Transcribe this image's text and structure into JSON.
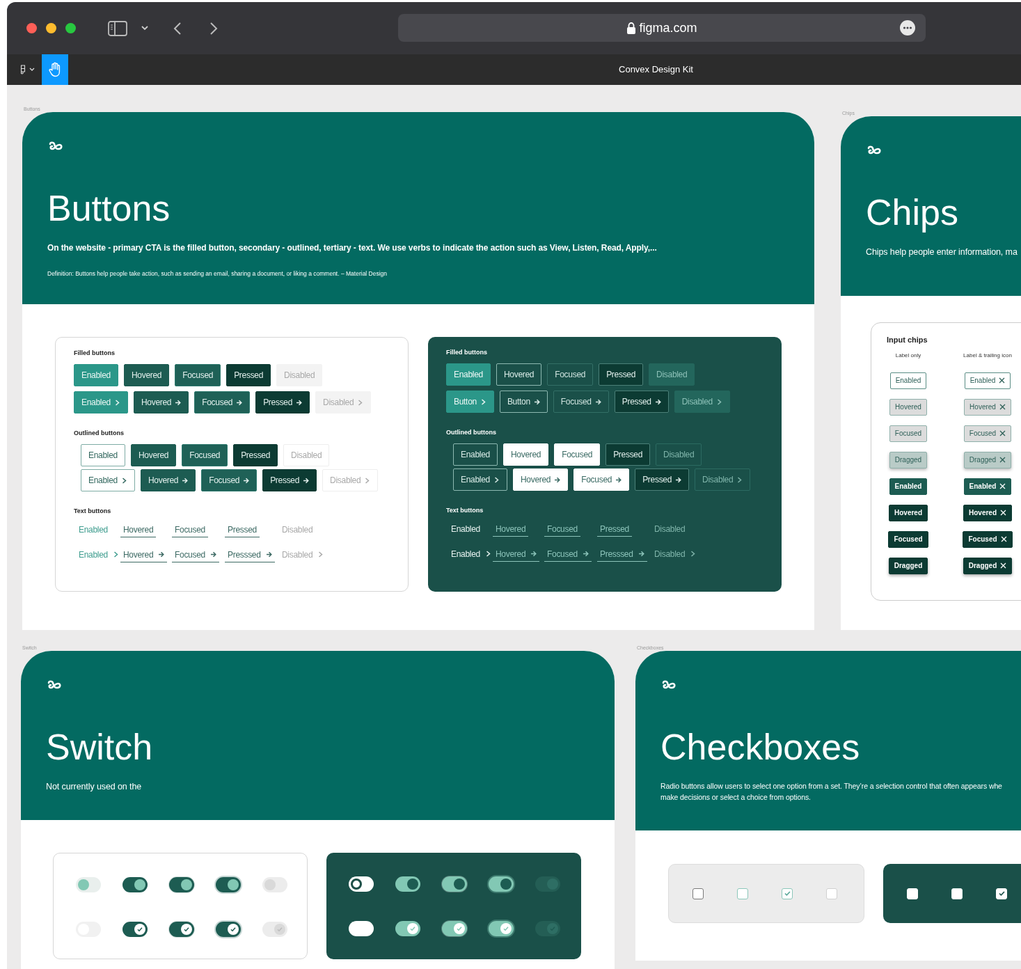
{
  "browser": {
    "url": "figma.com"
  },
  "app_bar": {
    "file_title": "Convex Design Kit",
    "tools": [
      {
        "kind": "main-menu",
        "selected": false
      },
      {
        "kind": "hand",
        "selected": true
      }
    ]
  },
  "frames": [
    {
      "kind": "buttons",
      "label": "Buttons",
      "title": "Buttons",
      "description": "On the website - primary CTA is the filled button, secondary - outlined, tertiary - text. We use verbs to indicate the action such as View, Listen, Read, Apply,...",
      "definition": "Definition: Buttons help people take action, such as sending an email, sharing a document, or liking a comment. – Material Design",
      "panels": [
        {
          "kind": "light",
          "sections": [
            {
              "kind": "filled",
              "title": "Filled buttons",
              "rows": [
                [
                  {
                    "label": "Enabled",
                    "kind": "enabled"
                  },
                  {
                    "label": "Hovered",
                    "kind": "hovered"
                  },
                  {
                    "label": "Focused",
                    "kind": "focused"
                  },
                  {
                    "label": "Pressed",
                    "kind": "pressed"
                  },
                  {
                    "label": "Disabled",
                    "kind": "disabled"
                  }
                ],
                [
                  {
                    "label": "Enabled",
                    "kind": "enabled"
                  },
                  {
                    "label": "Hovered",
                    "kind": "hovered"
                  },
                  {
                    "label": "Focused",
                    "kind": "focused"
                  },
                  {
                    "label": "Pressed",
                    "kind": "pressed"
                  },
                  {
                    "label": "Disabled",
                    "kind": "disabled"
                  }
                ]
              ]
            },
            {
              "kind": "outlined",
              "title": "Outlined buttons",
              "rows": [
                [
                  {
                    "label": "Enabled",
                    "kind": "enabled"
                  },
                  {
                    "label": "Hovered",
                    "kind": "hovered"
                  },
                  {
                    "label": "Focused",
                    "kind": "focused"
                  },
                  {
                    "label": "Pressed",
                    "kind": "pressed"
                  },
                  {
                    "label": "Disabled",
                    "kind": "disabled"
                  }
                ],
                [
                  {
                    "label": "Enabled",
                    "kind": "enabled"
                  },
                  {
                    "label": "Hovered",
                    "kind": "hovered"
                  },
                  {
                    "label": "Focused",
                    "kind": "focused"
                  },
                  {
                    "label": "Pressed",
                    "kind": "pressed"
                  },
                  {
                    "label": "Disabled",
                    "kind": "disabled"
                  }
                ]
              ]
            },
            {
              "kind": "text",
              "title": "Text buttons",
              "rows": [
                [
                  {
                    "label": "Enabled",
                    "kind": "enabled"
                  },
                  {
                    "label": "Hovered",
                    "kind": "hovered"
                  },
                  {
                    "label": "Focused",
                    "kind": "focused"
                  },
                  {
                    "label": "Pressed",
                    "kind": "pressed"
                  },
                  {
                    "label": "Disabled",
                    "kind": "disabled"
                  }
                ],
                [
                  {
                    "label": "Enabled",
                    "kind": "enabled"
                  },
                  {
                    "label": "Hovered",
                    "kind": "hovered"
                  },
                  {
                    "label": "Focused",
                    "kind": "focused"
                  },
                  {
                    "label": "Presssed",
                    "kind": "pressed"
                  },
                  {
                    "label": "Disabled",
                    "kind": "disabled"
                  }
                ]
              ]
            }
          ]
        },
        {
          "kind": "dark",
          "sections": [
            {
              "kind": "filled",
              "title": "Filled buttons",
              "rows": [
                [
                  {
                    "label": "Enabled",
                    "kind": "enabled"
                  },
                  {
                    "label": "Hovered",
                    "kind": "hovered"
                  },
                  {
                    "label": "Focused",
                    "kind": "focused"
                  },
                  {
                    "label": "Pressed",
                    "kind": "pressed"
                  },
                  {
                    "label": "Disabled",
                    "kind": "disabled"
                  }
                ],
                [
                  {
                    "label": "Button",
                    "kind": "enabled"
                  },
                  {
                    "label": "Button",
                    "kind": "hovered"
                  },
                  {
                    "label": "Focused",
                    "kind": "focused"
                  },
                  {
                    "label": "Pressed",
                    "kind": "pressed"
                  },
                  {
                    "label": "Disabled",
                    "kind": "disabled"
                  }
                ]
              ]
            },
            {
              "kind": "outlined",
              "title": "Outlined buttons",
              "rows": [
                [
                  {
                    "label": "Enabled",
                    "kind": "enabled"
                  },
                  {
                    "label": "Hovered",
                    "kind": "hovered"
                  },
                  {
                    "label": "Focused",
                    "kind": "focused"
                  },
                  {
                    "label": "Pressed",
                    "kind": "pressed"
                  },
                  {
                    "label": "Disabled",
                    "kind": "disabled"
                  }
                ],
                [
                  {
                    "label": "Enabled",
                    "kind": "enabled"
                  },
                  {
                    "label": "Hovered",
                    "kind": "hovered"
                  },
                  {
                    "label": "Focused",
                    "kind": "focused"
                  },
                  {
                    "label": "Pressed",
                    "kind": "pressed"
                  },
                  {
                    "label": "Disabled",
                    "kind": "disabled"
                  }
                ]
              ]
            },
            {
              "kind": "text",
              "title": "Text buttons",
              "rows": [
                [
                  {
                    "label": "Enabled",
                    "kind": "enabled"
                  },
                  {
                    "label": "Hovered",
                    "kind": "hovered"
                  },
                  {
                    "label": "Focused",
                    "kind": "focused"
                  },
                  {
                    "label": "Pressed",
                    "kind": "pressed"
                  },
                  {
                    "label": "Disabled",
                    "kind": "disabled"
                  }
                ],
                [
                  {
                    "label": "Enabled",
                    "kind": "enabled"
                  },
                  {
                    "label": "Hovered",
                    "kind": "hovered"
                  },
                  {
                    "label": "Focused",
                    "kind": "focused"
                  },
                  {
                    "label": "Presssed",
                    "kind": "pressed"
                  },
                  {
                    "label": "Disabled",
                    "kind": "disabled"
                  }
                ]
              ]
            }
          ]
        }
      ]
    },
    {
      "kind": "chips",
      "label": "Chips",
      "title": "Chips",
      "description": "Chips help people enter information, ma",
      "panels": [
        {
          "title": "Input chips",
          "columns": [
            {
              "header": "Label only",
              "chips": [
                {
                  "label": "Enabled",
                  "kind": "enabled"
                },
                {
                  "label": "Hovered",
                  "kind": "hovered"
                },
                {
                  "label": "Focused",
                  "kind": "focused"
                },
                {
                  "label": "Dragged",
                  "kind": "dragged"
                },
                {
                  "label": "Enabled",
                  "kind": "enabled"
                },
                {
                  "label": "Hovered",
                  "kind": "hovered"
                },
                {
                  "label": "Focused",
                  "kind": "focused"
                },
                {
                  "label": "Dragged",
                  "kind": "dragged"
                }
              ]
            },
            {
              "header": "Label & trailing icon",
              "chips": [
                {
                  "label": "Enabled",
                  "kind": "enabled"
                },
                {
                  "label": "Hovered",
                  "kind": "hovered"
                },
                {
                  "label": "Focused",
                  "kind": "focused"
                },
                {
                  "label": "Dragged",
                  "kind": "dragged"
                },
                {
                  "label": "Enabled",
                  "kind": "enabled"
                },
                {
                  "label": "Hovered",
                  "kind": "hovered"
                },
                {
                  "label": "Focused",
                  "kind": "focused"
                },
                {
                  "label": "Dragged",
                  "kind": "dragged"
                }
              ]
            }
          ]
        }
      ]
    },
    {
      "kind": "switch",
      "label": "Switch",
      "title": "Switch",
      "description": "Not currently used on the",
      "panels": [
        {
          "kind": "light",
          "rows": [
            [
              {
                "on": false,
                "kind": "enabled"
              },
              {
                "on": true,
                "kind": "enabled"
              },
              {
                "on": true,
                "kind": "hovered"
              },
              {
                "on": true,
                "kind": "focused"
              },
              {
                "on": false,
                "kind": "disabled"
              }
            ],
            [
              {
                "on": false,
                "kind": "enabled"
              },
              {
                "on": true,
                "kind": "enabled"
              },
              {
                "on": true,
                "kind": "hovered"
              },
              {
                "on": true,
                "kind": "focused"
              },
              {
                "on": true,
                "kind": "disabled"
              }
            ]
          ]
        },
        {
          "kind": "dark",
          "rows": [
            [
              {
                "on": false,
                "kind": "enabled"
              },
              {
                "on": true,
                "kind": "enabled"
              },
              {
                "on": true,
                "kind": "hovered"
              },
              {
                "on": true,
                "kind": "focused"
              },
              {
                "on": true,
                "kind": "disabled"
              }
            ],
            [
              {
                "on": false,
                "kind": "enabled"
              },
              {
                "on": true,
                "kind": "enabled"
              },
              {
                "on": true,
                "kind": "hovered"
              },
              {
                "on": true,
                "kind": "focused"
              },
              {
                "on": true,
                "kind": "disabled"
              }
            ]
          ]
        }
      ]
    },
    {
      "kind": "checkboxes",
      "label": "Checkboxes",
      "title": "Checkboxes",
      "description": [
        "Radio buttons allow users to select one option from a set. They’re a selection control that often appears whe",
        "make decisions or select a choice from options."
      ],
      "panels": [
        {
          "kind": "light",
          "boxes": [
            {
              "checked": false,
              "kind": "enabled"
            },
            {
              "checked": false,
              "kind": "hovered"
            },
            {
              "checked": true,
              "kind": "hovered"
            },
            {
              "checked": false,
              "kind": "disabled"
            }
          ]
        },
        {
          "kind": "dark",
          "boxes": [
            {
              "checked": false,
              "kind": "enabled"
            },
            {
              "checked": false,
              "kind": "hovered"
            },
            {
              "checked": true,
              "kind": "enabled"
            }
          ]
        }
      ]
    }
  ]
}
